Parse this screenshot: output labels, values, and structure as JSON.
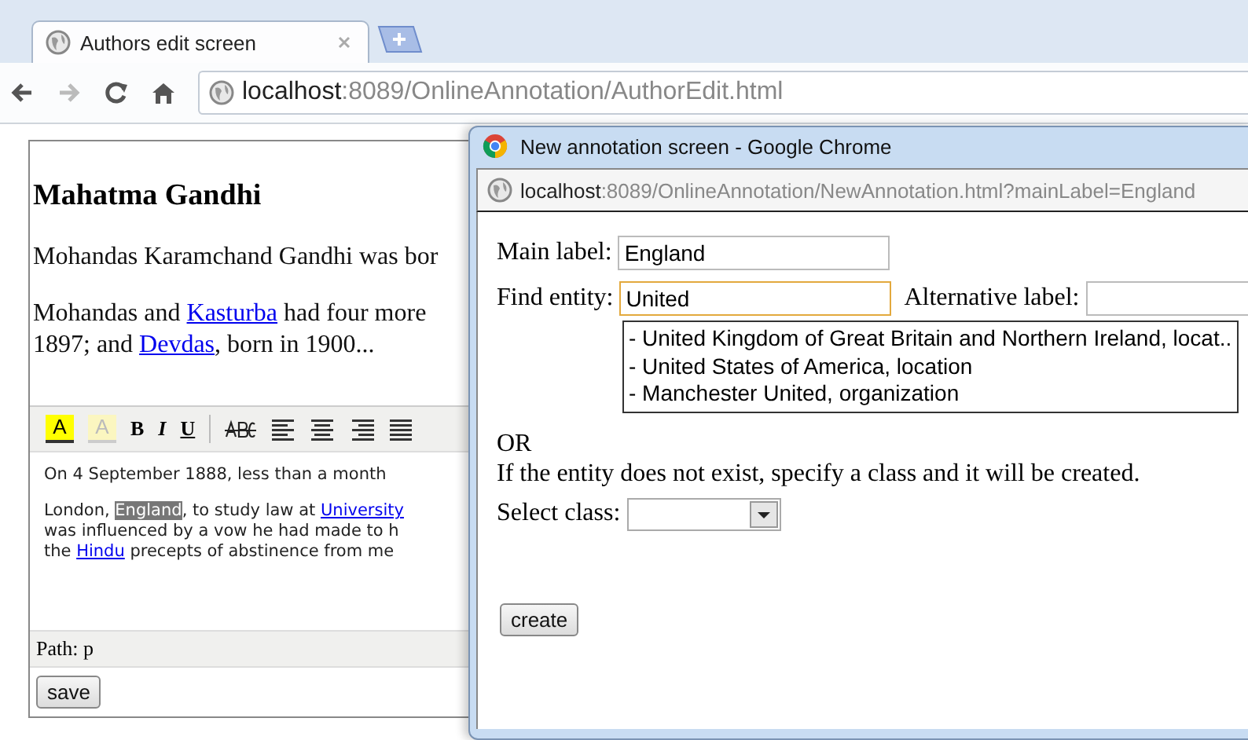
{
  "browser": {
    "tabs": [
      {
        "title": "Authors edit screen",
        "selected": true
      }
    ],
    "address": {
      "host": "localhost",
      "rest": ":8089/OnlineAnnotation/AuthorEdit.html"
    }
  },
  "page": {
    "heading": "Mahatma Gandhi",
    "paragraphs": [
      {
        "lines": [
          [
            {
              "text": "Mohandas Karamchand Gandhi was bor",
              "kind": "text"
            }
          ]
        ]
      },
      {
        "lines": [
          [
            {
              "text": "Mohandas and ",
              "kind": "text"
            },
            {
              "text": "Kasturba",
              "kind": "link"
            },
            {
              "text": " had four more",
              "kind": "text"
            }
          ],
          [
            {
              "text": "1897; and ",
              "kind": "text"
            },
            {
              "text": "Devdas",
              "kind": "link"
            },
            {
              "text": ", born in 1900...",
              "kind": "text"
            }
          ]
        ]
      }
    ]
  },
  "editor": {
    "toolbar": [
      {
        "kind": "text-color",
        "glyph": "A"
      },
      {
        "kind": "bg-color",
        "glyph": "A"
      },
      {
        "kind": "bold",
        "glyph": "B"
      },
      {
        "kind": "italic",
        "glyph": "I"
      },
      {
        "kind": "underline",
        "glyph": "U"
      },
      {
        "kind": "separator"
      },
      {
        "kind": "spellcheck"
      },
      {
        "kind": "align-left"
      },
      {
        "kind": "align-center"
      },
      {
        "kind": "align-right"
      },
      {
        "kind": "justify"
      }
    ],
    "paragraphs": [
      {
        "lines": [
          [
            {
              "text": "On 4 September 1888, less than a month",
              "kind": "text"
            }
          ]
        ]
      },
      {
        "lines": [
          [
            {
              "text": "London, ",
              "kind": "text"
            },
            {
              "text": "England",
              "kind": "selected"
            },
            {
              "text": ", to study law at ",
              "kind": "text"
            },
            {
              "text": "University",
              "kind": "link"
            }
          ],
          [
            {
              "text": "was influenced by a vow he had made to h",
              "kind": "text"
            }
          ],
          [
            {
              "text": "the ",
              "kind": "text"
            },
            {
              "text": "Hindu",
              "kind": "link"
            },
            {
              "text": " precepts of abstinence from me",
              "kind": "text"
            }
          ]
        ]
      }
    ],
    "path": "Path: p",
    "save_button": "save"
  },
  "popup": {
    "title": "New annotation screen - Google Chrome",
    "address": {
      "host": "localhost",
      "rest": ":8089/OnlineAnnotation/NewAnnotation.html?mainLabel=England"
    },
    "main_label": {
      "label": "Main label:",
      "value": "England",
      "focused": false
    },
    "find_entity": {
      "label": "Find entity:",
      "value": "United",
      "focused": true
    },
    "alternative_label": {
      "label": "Alternative label:",
      "focused": false
    },
    "suggestions": [
      "- United Kingdom of Great Britain and Northern Ireland, locat..",
      "- United States of America, location",
      "- Manchester United, organization"
    ],
    "or_text": "OR",
    "hint": "If the entity does not exist, specify a class and it will be created.",
    "select_class": {
      "label": "Select class:"
    },
    "create_button": "create"
  }
}
